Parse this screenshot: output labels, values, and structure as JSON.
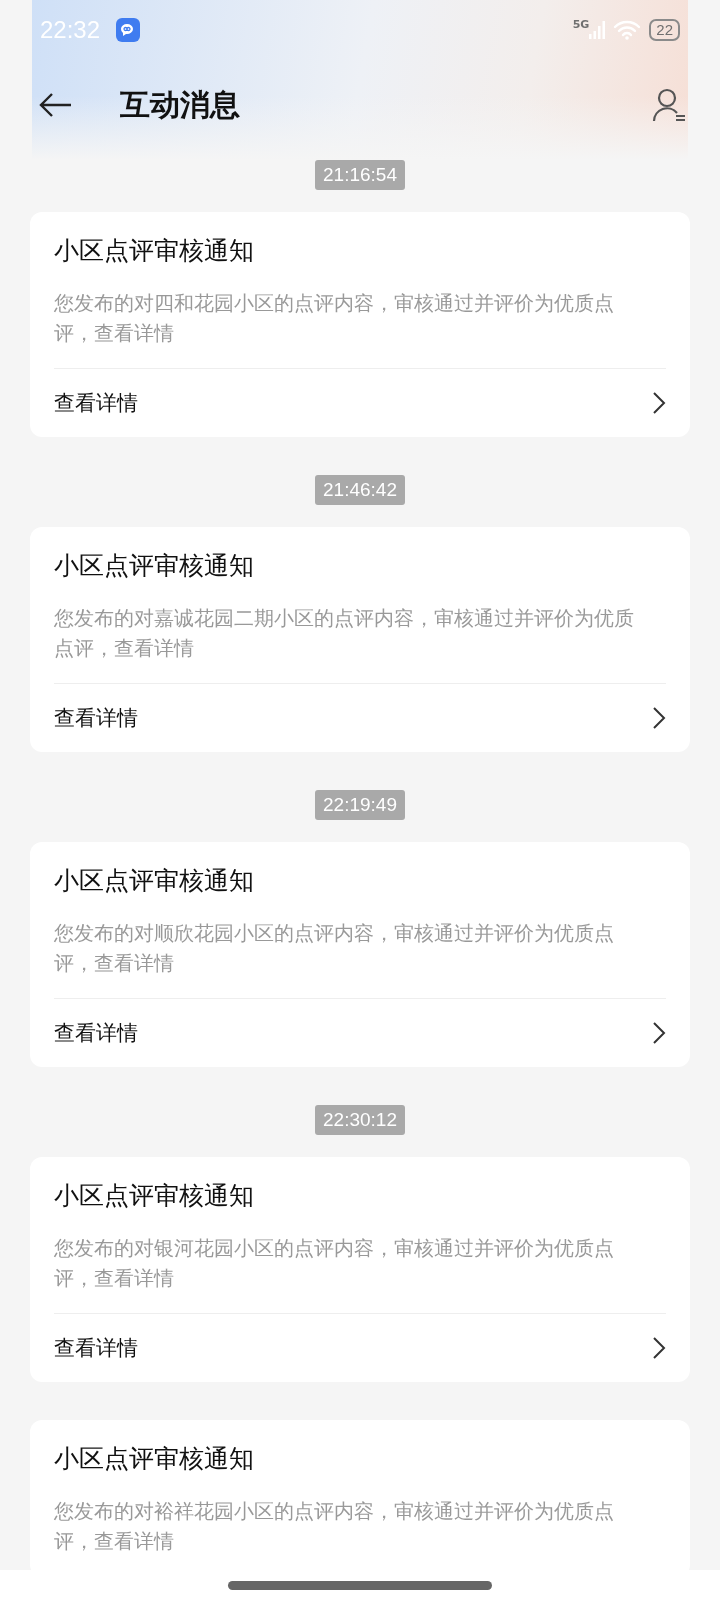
{
  "status_bar": {
    "time": "22:32",
    "network": "5G",
    "battery": "22"
  },
  "header": {
    "title": "互动消息"
  },
  "messages": [
    {
      "time": "21:16:54",
      "title": "小区点评审核通知",
      "body": "您发布的对四和花园小区的点评内容，审核通过并评价为优质点评，查看详情",
      "action": "查看详情"
    },
    {
      "time": "21:46:42",
      "title": "小区点评审核通知",
      "body": "您发布的对嘉诚花园二期小区的点评内容，审核通过并评价为优质点评，查看详情",
      "action": "查看详情"
    },
    {
      "time": "22:19:49",
      "title": "小区点评审核通知",
      "body": "您发布的对顺欣花园小区的点评内容，审核通过并评价为优质点评，查看详情",
      "action": "查看详情"
    },
    {
      "time": "22:30:12",
      "title": "小区点评审核通知",
      "body": "您发布的对银河花园小区的点评内容，审核通过并评价为优质点评，查看详情",
      "action": "查看详情"
    },
    {
      "title": "小区点评审核通知",
      "body": "您发布的对裕祥花园小区的点评内容，审核通过并评价为优质点评，查看详情"
    }
  ]
}
